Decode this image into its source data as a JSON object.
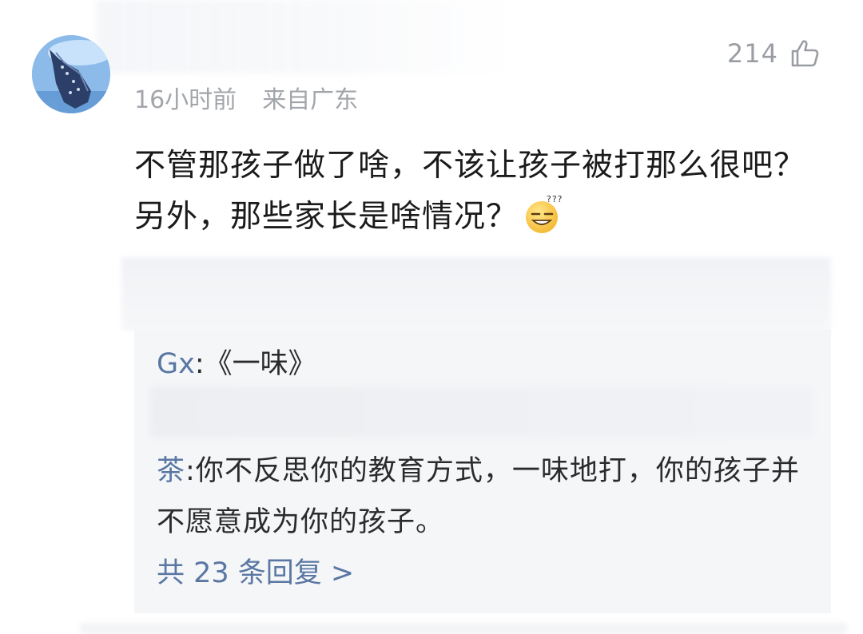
{
  "comment": {
    "like_count": "214",
    "meta": {
      "time": "16小时前",
      "location": "来自广东"
    },
    "text": "不管那孩子做了啥，不该让孩子被打那么很吧？另外，那些家长是啥情况？",
    "emoji": "dizzy-smile-emoji"
  },
  "replies": [
    {
      "author": "Gx",
      "separator": ":",
      "text": "《一味》"
    },
    {
      "author": "茶",
      "separator": ":",
      "text": "你不反思你的教育方式，一味地打，你的孩子并不愿意成为你的孩子。"
    }
  ],
  "more_replies": "共 23 条回复 >",
  "icons": {
    "like": "thumbs-up-icon",
    "avatar": "whale-shark-avatar"
  },
  "colors": {
    "author_link": "#5a77a3",
    "meta_gray": "#a2a5aa",
    "reply_bg": "#f5f6f8"
  }
}
